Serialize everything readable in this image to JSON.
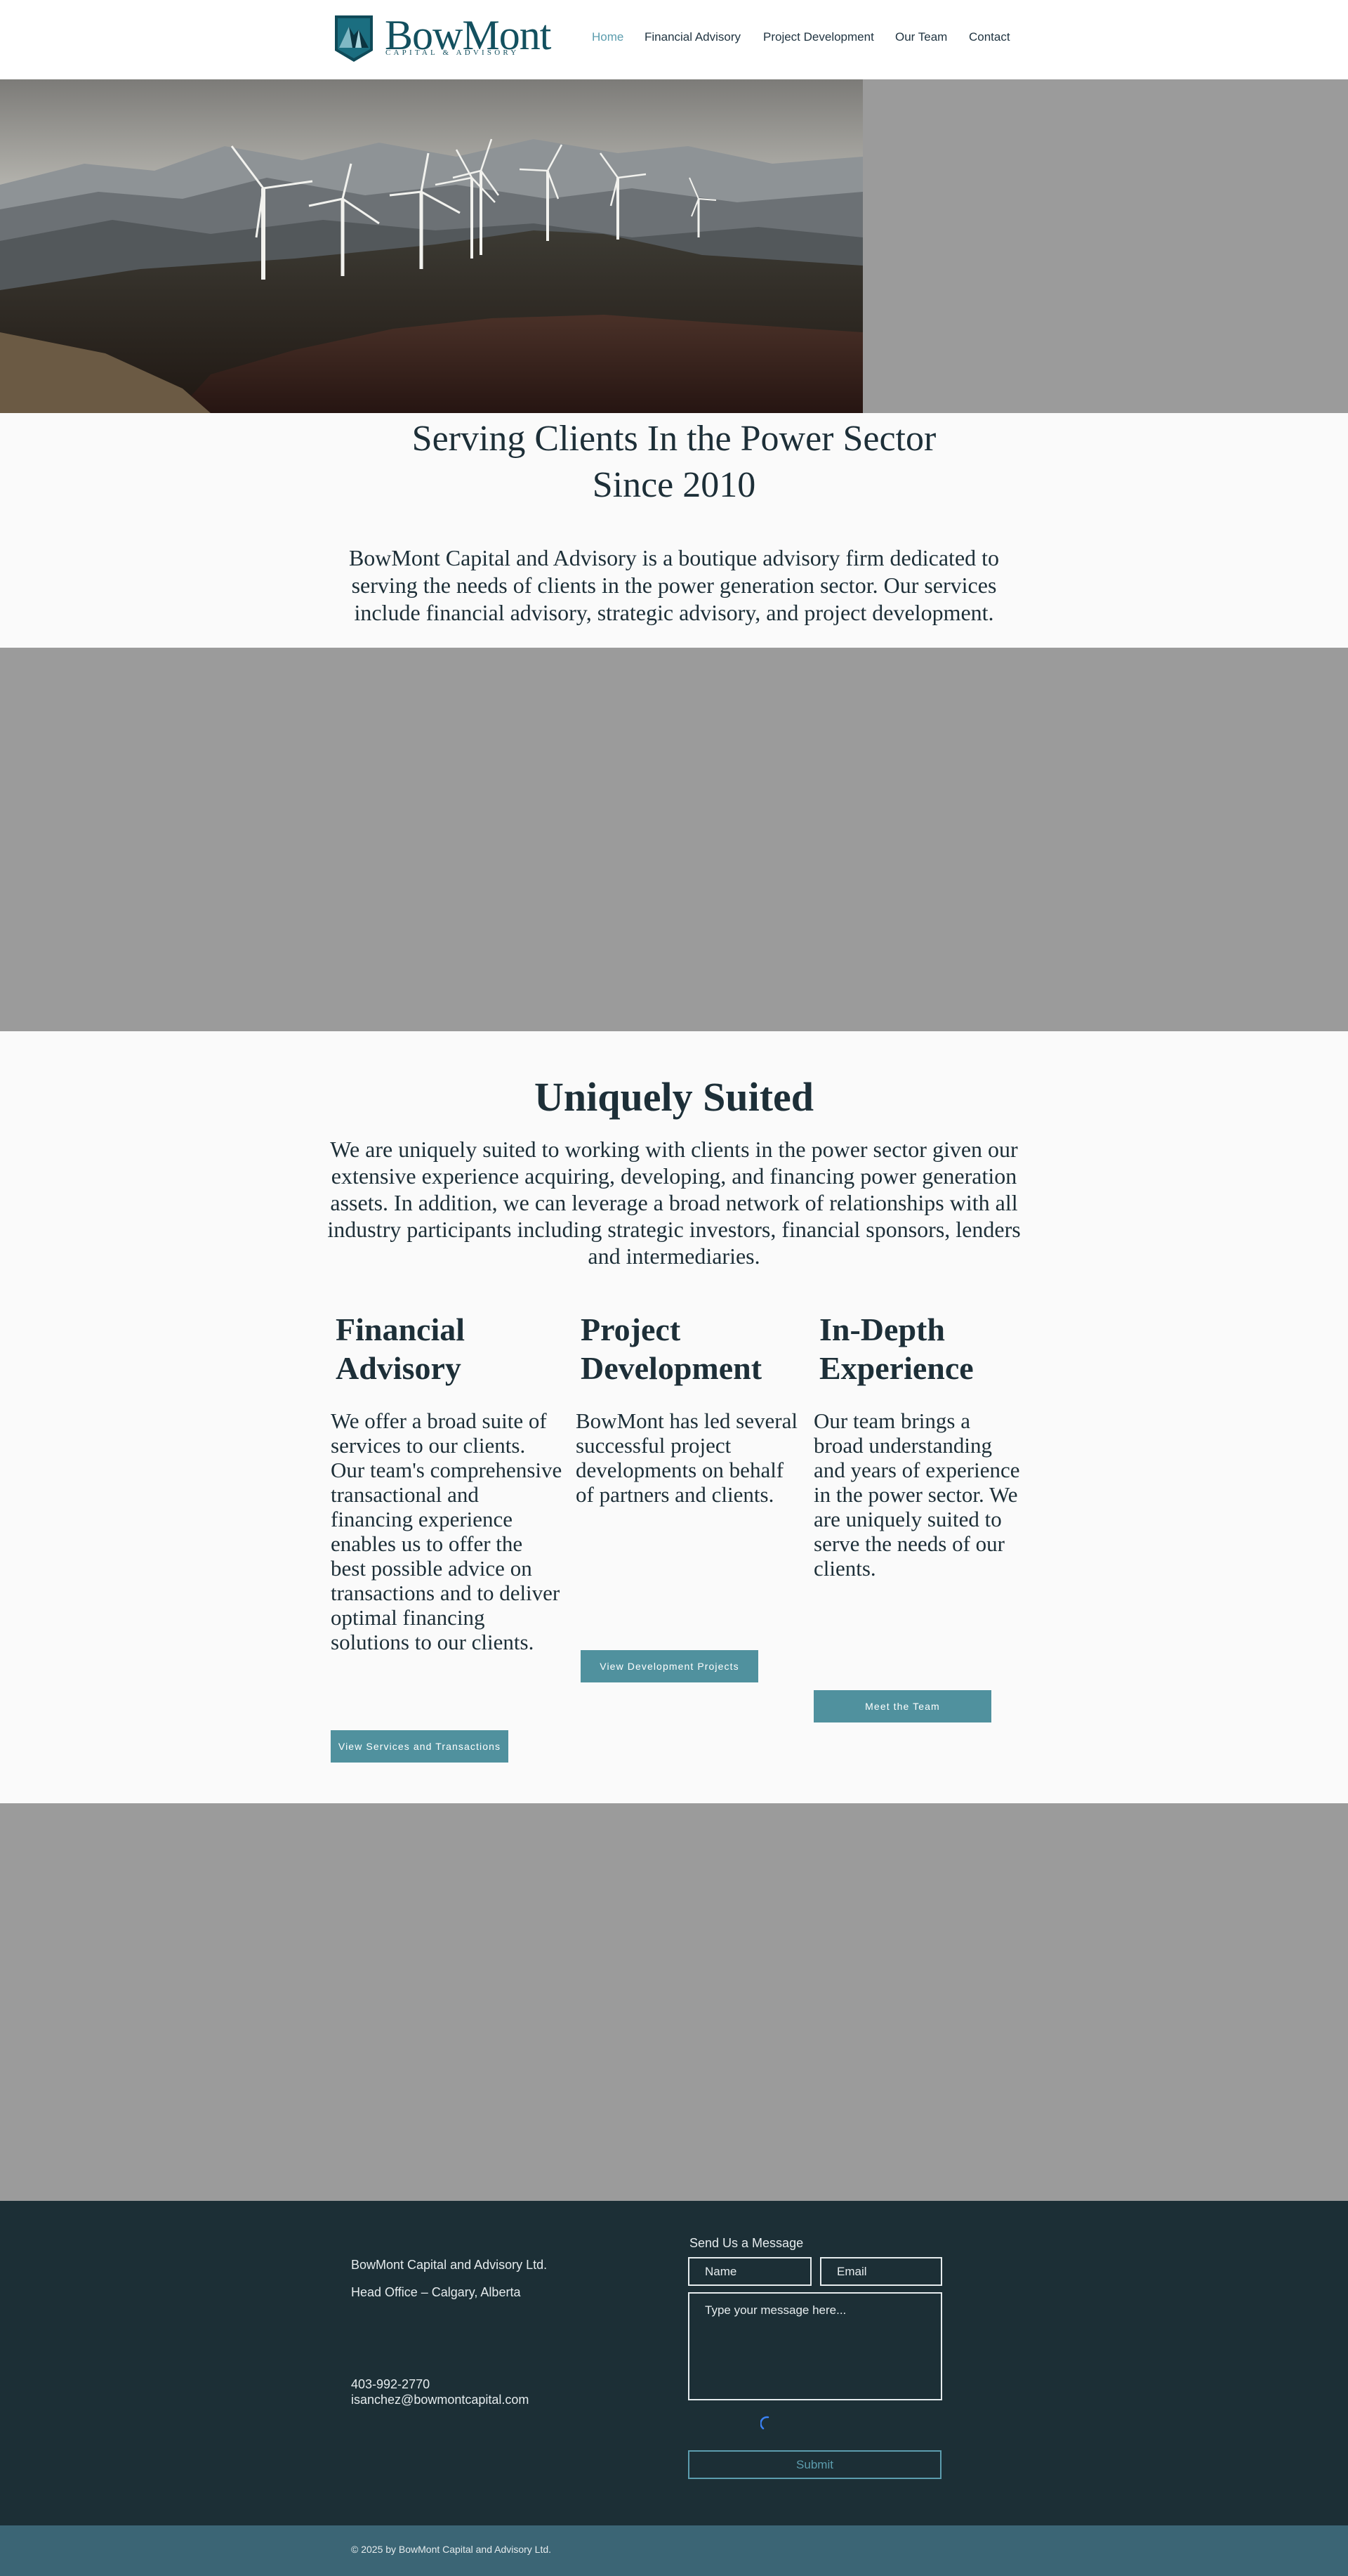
{
  "brand": {
    "name": "BowMont",
    "tagline": "CAPITAL & ADVISORY"
  },
  "nav": {
    "items": [
      {
        "label": "Home",
        "active": true
      },
      {
        "label": "Financial Advisory",
        "active": false
      },
      {
        "label": "Project Development",
        "active": false
      },
      {
        "label": "Our Team",
        "active": false
      },
      {
        "label": "Contact",
        "active": false
      }
    ]
  },
  "hero": {
    "image": "wind-turbines-mountains"
  },
  "intro": {
    "title_line1": "Serving Clients In the Power Sector",
    "title_line2": "Since 2010",
    "text": "BowMont Capital and Advisory is a boutique advisory firm dedicated to serving the needs of clients in the power generation sector. Our services include financial advisory, strategic advisory, and project development."
  },
  "unique": {
    "title": "Uniquely Suited",
    "text": "We are uniquely suited to working with clients in the power sector given our extensive experience acquiring, developing, and financing power generation assets. In addition, we can leverage a broad network of relationships with all industry participants including strategic investors, financial sponsors, lenders and intermediaries.",
    "columns": [
      {
        "title": "Financial Advisory",
        "text": "We offer a broad suite of services to our clients. Our team's comprehensive transactional and financing experience enables us to offer the best possible advice on transactions and to deliver optimal financing solutions to our clients.",
        "button": "View Services and Transactions"
      },
      {
        "title": "Project Development",
        "text": "BowMont has led several successful project developments on behalf of partners and clients.",
        "button": "View Development Projects"
      },
      {
        "title": "In-Depth Experience",
        "text": "Our team brings a broad understanding and years of experience in the power sector. We are uniquely suited to serve the needs of our clients.",
        "button": "Meet the Team"
      }
    ]
  },
  "footer": {
    "company": "BowMont Capital and Advisory Ltd.",
    "office": "Head Office – Calgary, Alberta",
    "phone": "403-992-2770",
    "email": "isanchez@bowmontcapital.com",
    "form_title": "Send Us a Message",
    "name_placeholder": "Name",
    "email_placeholder": "Email",
    "message_placeholder": "Type your message here...",
    "submit_label": "Submit",
    "copyright": "© 2025 by BowMont Capital and Advisory Ltd."
  },
  "colors": {
    "brand": "#13505f",
    "accent": "#5c9dae",
    "button": "#50919e",
    "footer": "#1c2f36",
    "bottom_bar": "#3b6575",
    "placeholder_gray": "#9b9b9b"
  }
}
